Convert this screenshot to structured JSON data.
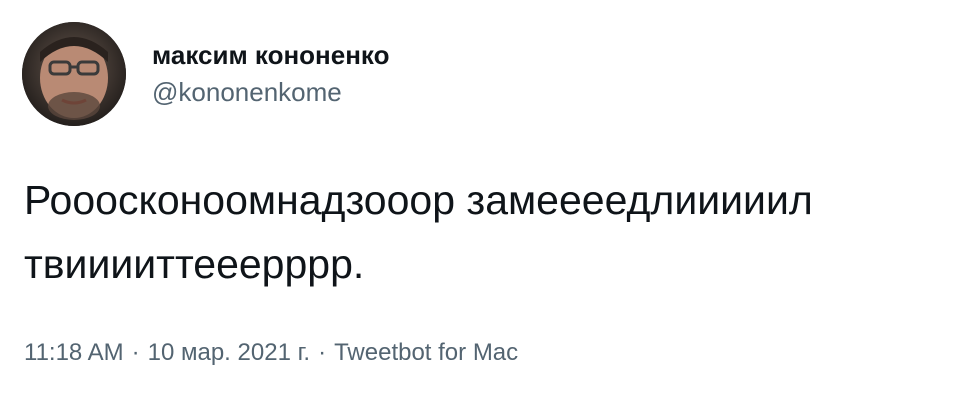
{
  "tweet": {
    "author": {
      "display_name": "максим кононенко",
      "handle": "@kononenkome",
      "avatar_icon": "user-avatar-photo"
    },
    "text": "Рооосконоомнадзооор замеееедлииииил твииииттееерррр.",
    "meta": {
      "time": "11:18 AM",
      "date": "10 мар. 2021 г.",
      "source": "Tweetbot for Mac",
      "separator": "·"
    },
    "colors": {
      "text": "#0f1419",
      "secondary": "#536471",
      "background": "#ffffff"
    }
  }
}
